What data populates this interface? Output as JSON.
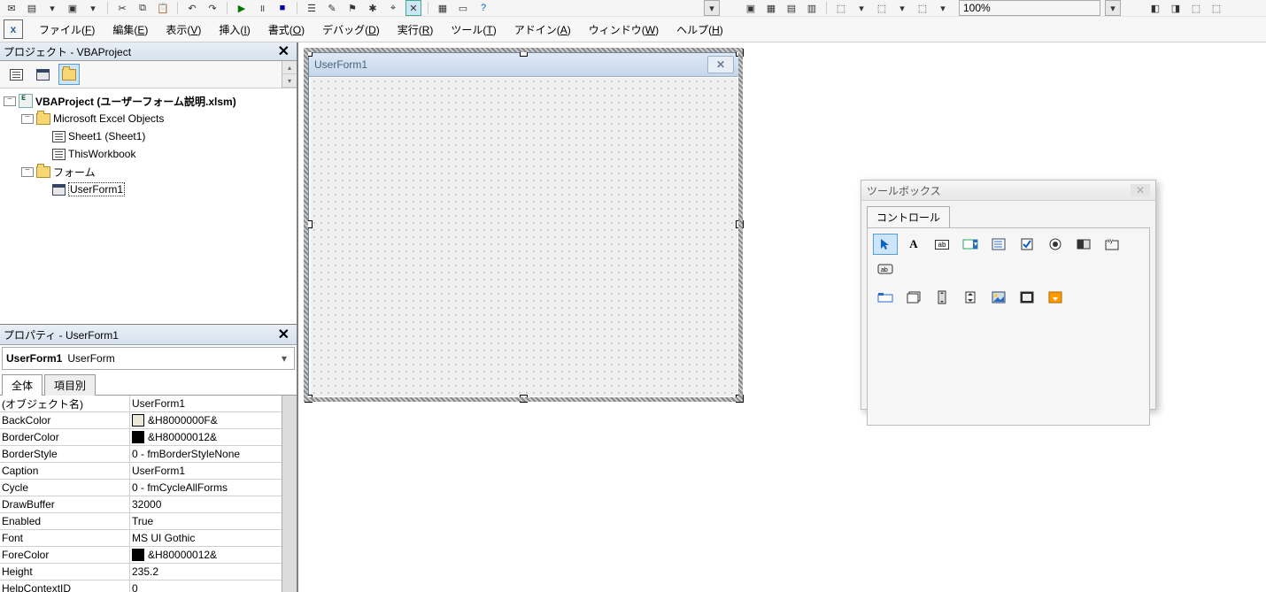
{
  "zoom": "100%",
  "menubar": [
    {
      "label": "ファイル",
      "u": "F"
    },
    {
      "label": "編集",
      "u": "E"
    },
    {
      "label": "表示",
      "u": "V"
    },
    {
      "label": "挿入",
      "u": "I"
    },
    {
      "label": "書式",
      "u": "O"
    },
    {
      "label": "デバッグ",
      "u": "D"
    },
    {
      "label": "実行",
      "u": "R"
    },
    {
      "label": "ツール",
      "u": "T"
    },
    {
      "label": "アドイン",
      "u": "A"
    },
    {
      "label": "ウィンドウ",
      "u": "W"
    },
    {
      "label": "ヘルプ",
      "u": "H"
    }
  ],
  "project_pane_title": "プロジェクト - VBAProject",
  "tree": {
    "root": "VBAProject (ユーザーフォーム説明.xlsm)",
    "excel_objects_label": "Microsoft Excel Objects",
    "sheet1": "Sheet1 (Sheet1)",
    "thisworkbook": "ThisWorkbook",
    "forms_label": "フォーム",
    "userform": "UserForm1"
  },
  "prop_pane_title": "プロパティ - UserForm1",
  "prop_selector_name": "UserForm1",
  "prop_selector_type": "UserForm",
  "prop_tabs": {
    "all": "全体",
    "cat": "項目別"
  },
  "props": [
    {
      "k": "(オブジェクト名)",
      "v": "UserForm1"
    },
    {
      "k": "BackColor",
      "v": "&H8000000F&",
      "swatch": "#ece9d8"
    },
    {
      "k": "BorderColor",
      "v": "&H80000012&",
      "swatch": "#000000"
    },
    {
      "k": "BorderStyle",
      "v": "0 - fmBorderStyleNone"
    },
    {
      "k": "Caption",
      "v": "UserForm1"
    },
    {
      "k": "Cycle",
      "v": "0 - fmCycleAllForms"
    },
    {
      "k": "DrawBuffer",
      "v": "32000"
    },
    {
      "k": "Enabled",
      "v": "True"
    },
    {
      "k": "Font",
      "v": "MS UI Gothic"
    },
    {
      "k": "ForeColor",
      "v": "&H80000012&",
      "swatch": "#000000"
    },
    {
      "k": "Height",
      "v": "235.2"
    },
    {
      "k": "HelpContextID",
      "v": "0"
    }
  ],
  "form_caption": "UserForm1",
  "toolbox": {
    "title": "ツールボックス",
    "tab": "コントロール",
    "tools_row1": [
      "pointer",
      "label",
      "textbox",
      "combobox",
      "listbox",
      "checkbox",
      "optionbutton",
      "togglebutton",
      "frame",
      "commandbutton"
    ],
    "tools_row2": [
      "tabstrip",
      "multipage",
      "scrollbar",
      "spinbutton",
      "image",
      "refedit",
      "webbrowser"
    ]
  }
}
